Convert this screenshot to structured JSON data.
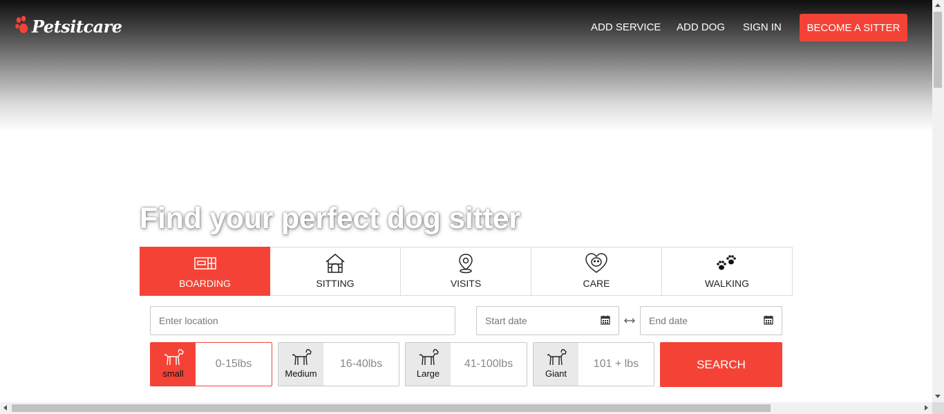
{
  "brand": {
    "name": "Petsitcare",
    "paw_color": "#f44336"
  },
  "nav": {
    "add_service": "ADD SERVICE",
    "add_dog": "ADD DOG",
    "sign_in": "SIGN IN",
    "become_sitter": "BECOME A SITTER"
  },
  "hero": {
    "title": "Find your perfect dog sitter"
  },
  "tabs": [
    {
      "label": "BOARDING",
      "icon": "boarding-icon",
      "active": true
    },
    {
      "label": "SITTING",
      "icon": "doghouse-icon",
      "active": false
    },
    {
      "label": "VISITS",
      "icon": "location-pin-icon",
      "active": false
    },
    {
      "label": "CARE",
      "icon": "heart-dog-icon",
      "active": false
    },
    {
      "label": "WALKING",
      "icon": "paw-prints-icon",
      "active": false
    }
  ],
  "search": {
    "location_placeholder": "Enter location",
    "start_date_placeholder": "Start date",
    "end_date_placeholder": "End date",
    "button_label": "SEARCH"
  },
  "sizes": [
    {
      "name": "small",
      "range": "0-15lbs",
      "active": true
    },
    {
      "name": "Medium",
      "range": "16-40lbs",
      "active": false
    },
    {
      "name": "Large",
      "range": "41-100lbs",
      "active": false
    },
    {
      "name": "Giant",
      "range": "101 + lbs",
      "active": false
    }
  ],
  "colors": {
    "accent": "#f44336"
  }
}
